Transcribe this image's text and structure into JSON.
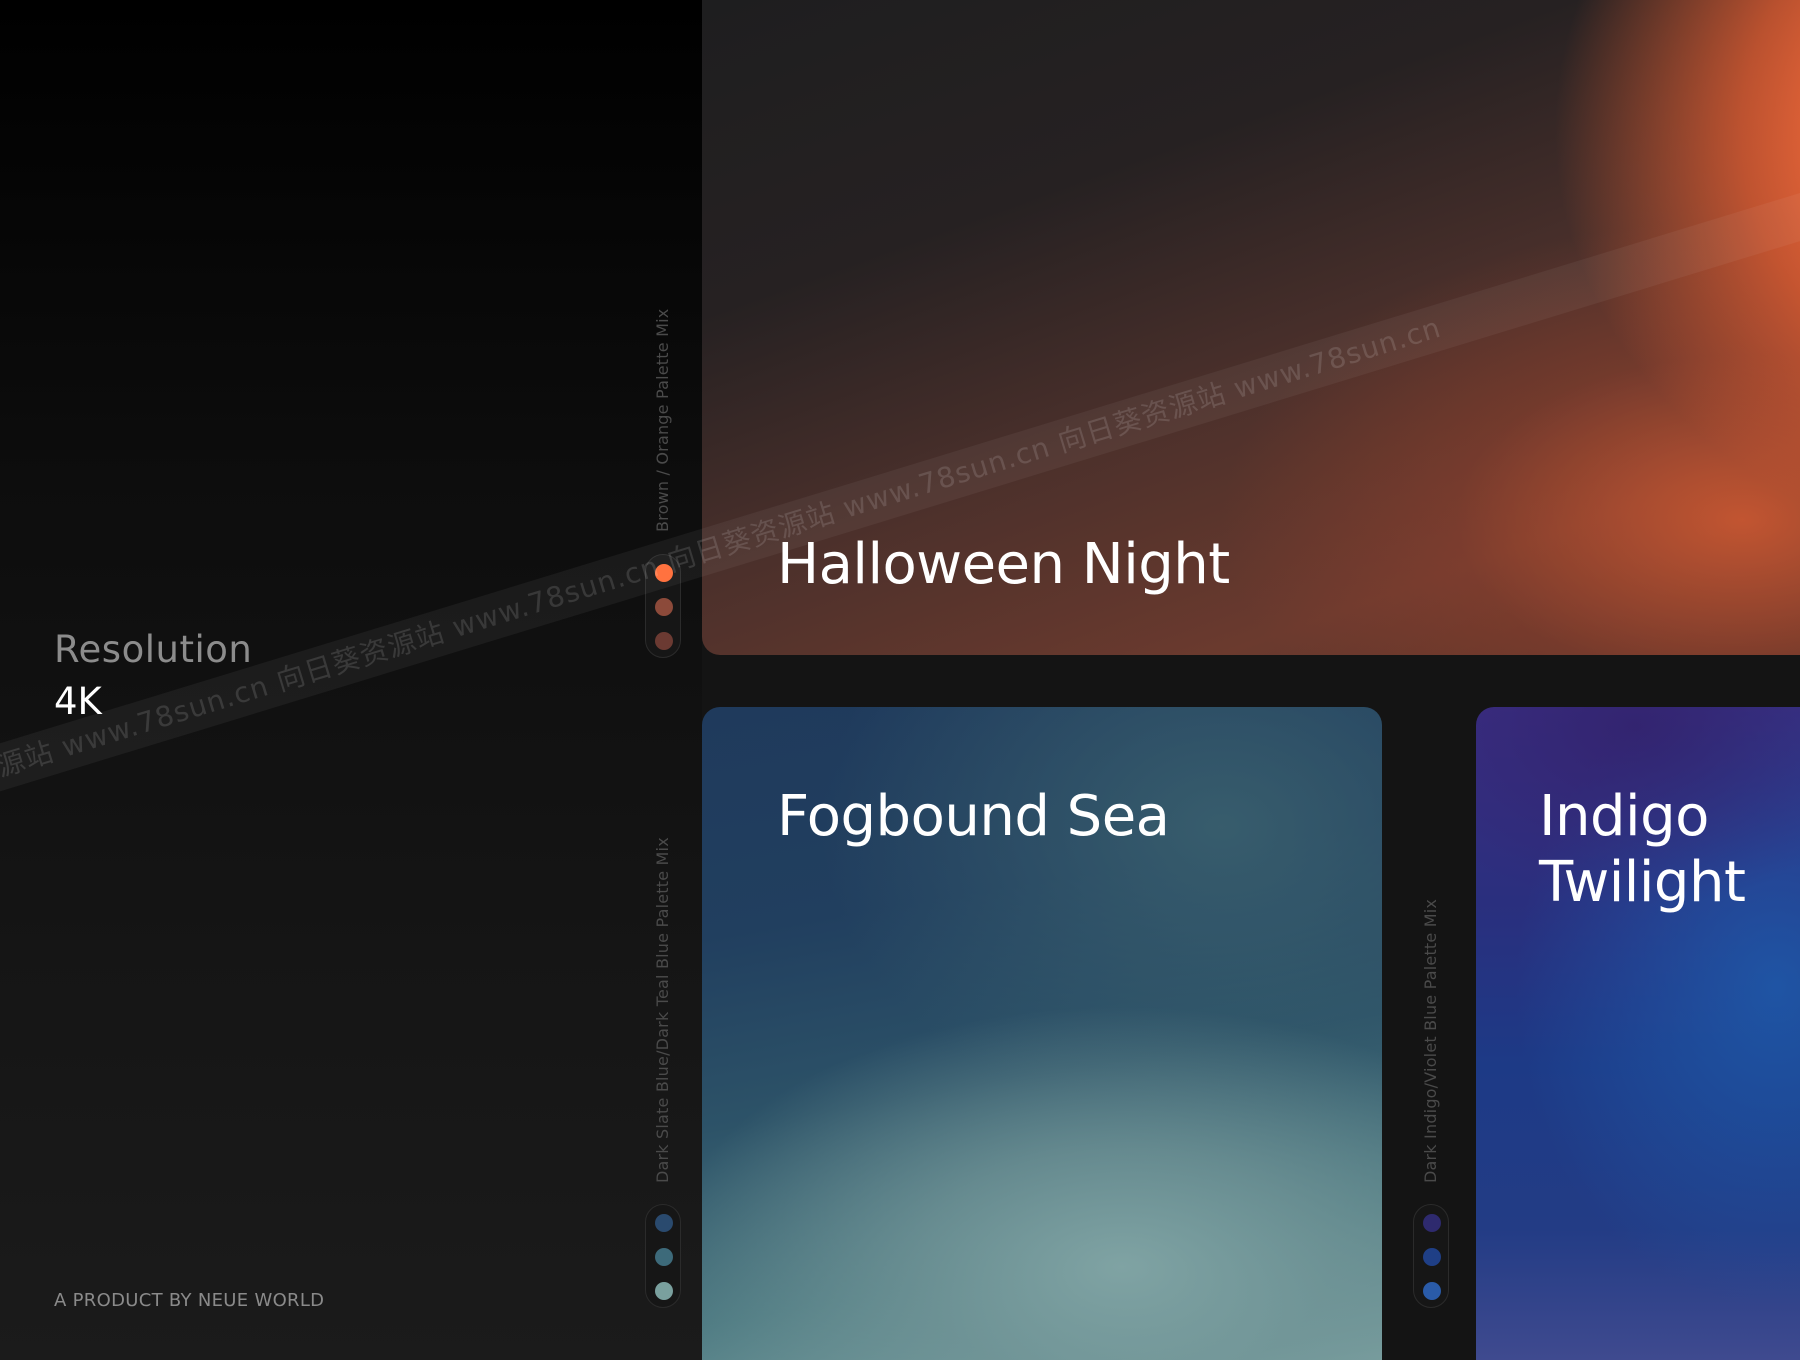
{
  "sidebar": {
    "resolution_label": "Resolution",
    "resolution_value": "4K",
    "product_credit": "A PRODUCT BY NEUE WORLD"
  },
  "gradients": [
    {
      "title": "Halloween Night",
      "palette_label": "Brown / Orange Palette Mix",
      "swatches": [
        "#ff6b35",
        "#8c4a3a",
        "#6b3a32"
      ]
    },
    {
      "title": "Fogbound Sea",
      "palette_label": "Dark Slate Blue/Dark Teal Blue Palette Mix",
      "swatches": [
        "#2a4a6e",
        "#3d6a7a",
        "#7aa09e"
      ]
    },
    {
      "title": "Indigo Twilight",
      "palette_label": "Dark Indigo/Violet Blue Palette Mix",
      "swatches": [
        "#2e2a6e",
        "#1f3f86",
        "#2a5ba8"
      ]
    }
  ],
  "watermark": {
    "text": "向日葵资源站  www.78sun.cn  向日葵资源站  www.78sun.cn  向日葵资源站  www.78sun.cn  向日葵资源站  www.78sun.cn"
  }
}
